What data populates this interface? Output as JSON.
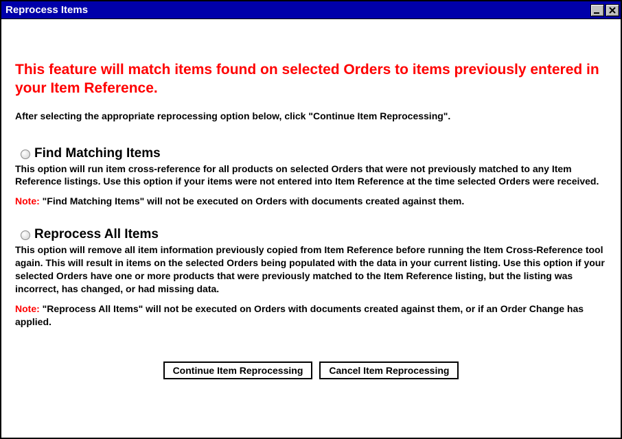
{
  "window": {
    "title": "Reprocess Items"
  },
  "headline": "This feature will match items found on selected Orders to items previously entered in your Item Reference.",
  "instruction": "After selecting the appropriate reprocessing option below, click \"Continue Item Reprocessing\".",
  "options": [
    {
      "title": "Find Matching Items",
      "desc": "This option will run item cross-reference for all products on selected Orders that were not previously matched to any Item Reference listings. Use this option if your items were not entered into Item Reference at the time selected Orders were received.",
      "note_label": "Note:",
      "note_text": " \"Find Matching Items\" will not be executed on Orders with documents created against them."
    },
    {
      "title": "Reprocess All Items",
      "desc": "This option will remove all item information previously copied from Item Reference before running the Item Cross-Reference tool again. This will result in items on the selected Orders being populated with the data in your current listing. Use this option if your selected Orders have one or more products that were previously matched to the Item Reference listing, but the listing was incorrect, has changed, or had missing data.",
      "note_label": "Note:",
      "note_text": " \"Reprocess All Items\" will not be executed on Orders with documents created against them, or if an Order Change has applied."
    }
  ],
  "buttons": {
    "continue": "Continue Item Reprocessing",
    "cancel": "Cancel Item Reprocessing"
  }
}
